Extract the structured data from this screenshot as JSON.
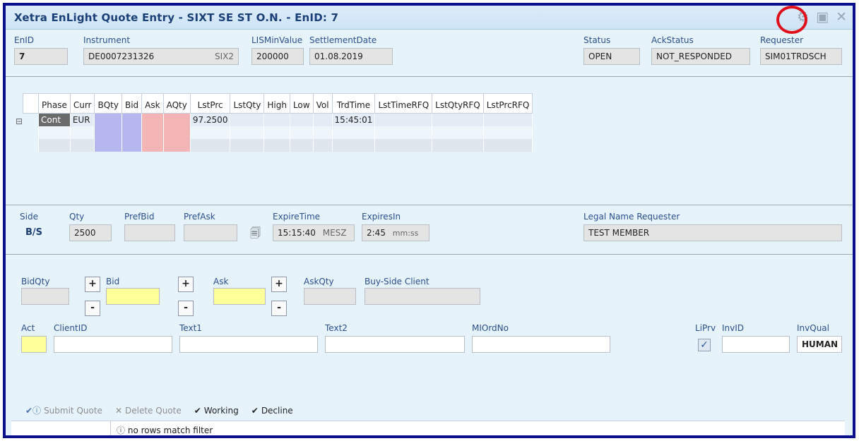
{
  "window": {
    "title": "Xetra EnLight Quote Entry - SIXT SE ST O.N. - EnID: 7"
  },
  "header": {
    "enid_label": "EnID",
    "enid_value": "7",
    "instrument_label": "Instrument",
    "instrument_value": "DE0007231326",
    "instrument_suffix": "SIX2",
    "lis_label": "LISMinValue",
    "lis_value": "200000",
    "settlement_label": "SettlementDate",
    "settlement_value": "01.08.2019",
    "status_label": "Status",
    "status_value": "OPEN",
    "ack_label": "AckStatus",
    "ack_value": "NOT_RESPONDED",
    "requester_label": "Requester",
    "requester_value": "SIM01TRDSCH"
  },
  "grid": {
    "columns": [
      "Phase",
      "Curr",
      "BQty",
      "Bid",
      "Ask",
      "AQty",
      "LstPrc",
      "LstQty",
      "High",
      "Low",
      "Vol",
      "TrdTime",
      "LstTimeRFQ",
      "LstQtyRFQ",
      "LstPrcRFQ"
    ],
    "rows": [
      [
        "Cont",
        "EUR",
        "",
        "",
        "",
        "",
        "97.2500",
        "",
        "",
        "",
        "",
        "15:45:01",
        "",
        "",
        ""
      ],
      [
        "",
        "",
        "",
        "",
        "",
        "",
        "",
        "",
        "",
        "",
        "",
        "",
        "",
        "",
        ""
      ],
      [
        "",
        "",
        "",
        "",
        "",
        "",
        "",
        "",
        "",
        "",
        "",
        "",
        "",
        "",
        ""
      ]
    ]
  },
  "side": {
    "side_label": "Side",
    "side_value": "B/S",
    "qty_label": "Qty",
    "qty_value": "2500",
    "prefbid_label": "PrefBid",
    "prefask_label": "PrefAsk",
    "expire_label": "ExpireTime",
    "expire_value": "15:15:40",
    "expire_suffix": "MESZ",
    "expiresin_label": "ExpiresIn",
    "expiresin_value": "2:45",
    "expiresin_suffix": "mm:ss",
    "legal_label": "Legal Name Requester",
    "legal_value": "TEST MEMBER"
  },
  "quote": {
    "bidqty_label": "BidQty",
    "bid_label": "Bid",
    "ask_label": "Ask",
    "askqty_label": "AskQty",
    "buyside_label": "Buy-Side Client",
    "plus": "+",
    "minus": "-",
    "act_label": "Act",
    "clientid_label": "ClientID",
    "text1_label": "Text1",
    "text2_label": "Text2",
    "miordno_label": "MIOrdNo",
    "liprv_label": "LiPrv",
    "invid_label": "InvID",
    "invqual_label": "InvQual",
    "invqual_value": "HUMAN",
    "liprv_checked": true
  },
  "toolbar": {
    "submit": "Submit Quote",
    "delete": "Delete Quote",
    "working": "Working",
    "decline": "Decline"
  },
  "statusbar": {
    "message": "no rows match filter"
  },
  "colors": {
    "frame": "#0a0f8c",
    "highlight": "#e0101a",
    "bid": "#b7b7f0",
    "ask": "#f2b4b4",
    "input_yellow": "#ffff99"
  }
}
